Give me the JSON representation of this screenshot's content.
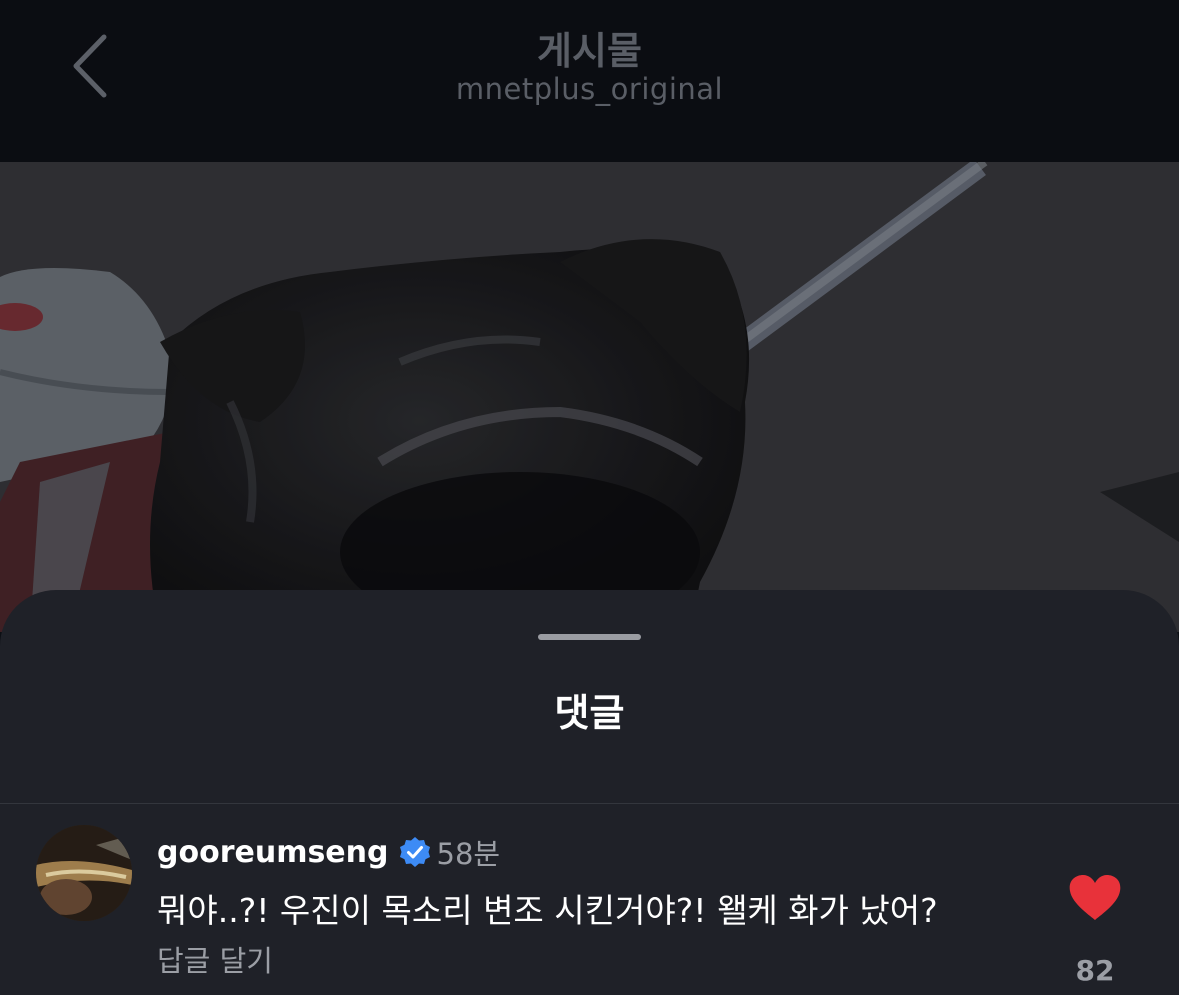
{
  "header": {
    "title": "게시물",
    "subtitle": "mnetplus_original"
  },
  "photo": {
    "subject": "dog-photo"
  },
  "sheet": {
    "title": "댓글"
  },
  "comment": {
    "username": "gooreumseng",
    "verified": true,
    "time": "58분",
    "text": "뭐야..?! 우진이 목소리 변조 시킨거야?! 왤케 화가 났어?",
    "reply_label": "답글 달기",
    "like_count": "82",
    "liked": true
  },
  "colors": {
    "accent_like": "#e8323a",
    "verified_blue": "#3d8bf5",
    "sheet_bg": "#1f2128",
    "header_bg": "#0b0d12"
  }
}
